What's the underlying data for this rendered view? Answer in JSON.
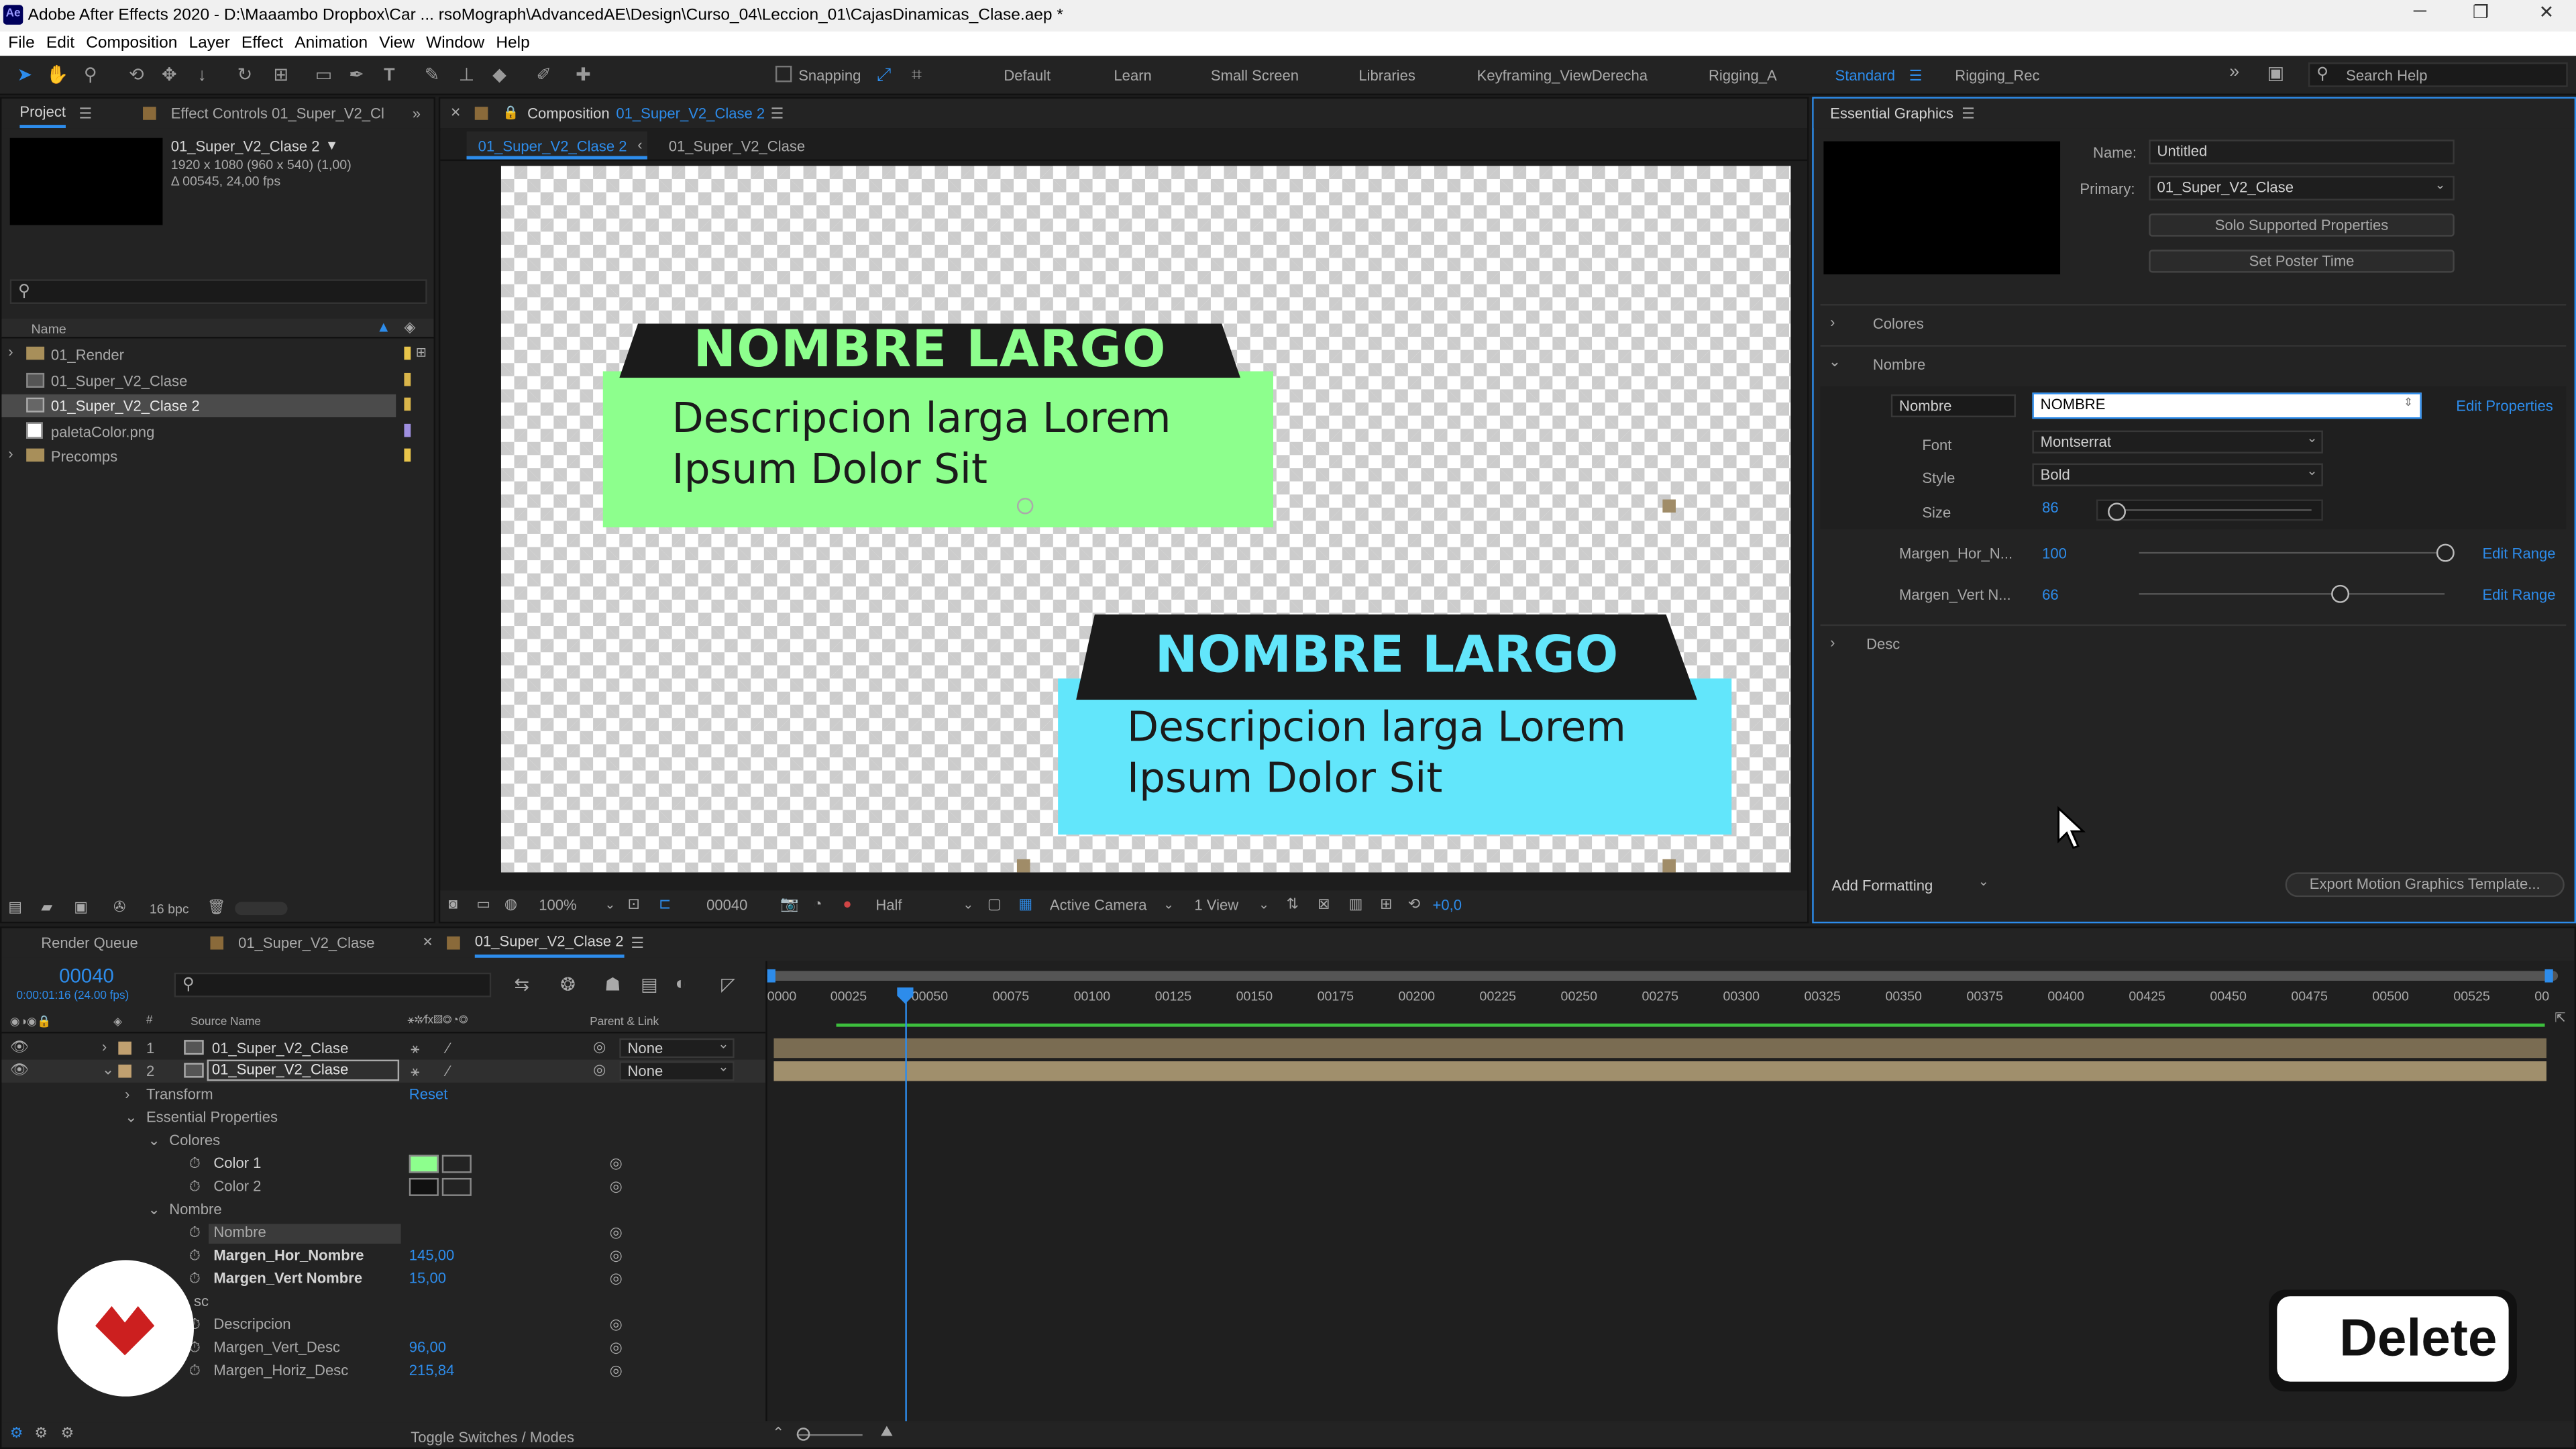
{
  "window": {
    "title": "Adobe After Effects 2020 - D:\\Maaambo Dropbox\\Car ... rsoMograph\\AdvancedAE\\Design\\Curso_04\\Leccion_01\\CajasDinamicas_Clase.aep *",
    "logo": "Ae"
  },
  "menu": [
    "File",
    "Edit",
    "Composition",
    "Layer",
    "Effect",
    "Animation",
    "View",
    "Window",
    "Help"
  ],
  "toolbar": {
    "snapping": "Snapping",
    "search_placeholder": "Search Help"
  },
  "workspaces": [
    "Default",
    "Learn",
    "Small Screen",
    "Libraries",
    "Keyframing_ViewDerecha",
    "Rigging_A",
    "Standard",
    "Rigging_Rec"
  ],
  "project": {
    "tab": "Project",
    "effect_tab": "Effect Controls 01_Super_V2_Cl",
    "item_name": "01_Super_V2_Clase 2",
    "item_info1": "1920 x 1080  (960 x 540) (1,00)",
    "item_info2": "Δ 00545, 24,00 fps",
    "col_name": "Name",
    "items": [
      {
        "name": "01_Render",
        "type": "folder",
        "color": "#e8c44a"
      },
      {
        "name": "01_Super_V2_Clase",
        "type": "comp",
        "color": "#d9b54a"
      },
      {
        "name": "01_Super_V2_Clase 2",
        "type": "comp",
        "color": "#d9b54a"
      },
      {
        "name": "paletaColor.png",
        "type": "image",
        "color": "#9f8fe0"
      },
      {
        "name": "Precomps",
        "type": "folder",
        "color": "#e8c44a"
      }
    ],
    "bpc": "16 bpc"
  },
  "comp": {
    "tab_label": "Composition",
    "tab_name": "01_Super_V2_Clase 2",
    "crumb1": "01_Super_V2_Clase 2",
    "crumb2": "01_Super_V2_Clase",
    "card1": {
      "title": "NOMBRE LARGO",
      "desc1": "Descripcion larga Lorem",
      "desc2": "Ipsum Dolor Sit",
      "color": "#8dff8d"
    },
    "card2": {
      "title": "NOMBRE LARGO",
      "desc1": "Descripcion larga Lorem",
      "desc2": "Ipsum Dolor Sit",
      "color": "#62e6fb"
    },
    "zoom": "100%",
    "time": "00040",
    "resolution": "Half",
    "camera": "Active Camera",
    "view": "1 View",
    "exposure": "+0,0"
  },
  "eg": {
    "title": "Essential Graphics",
    "name_label": "Name:",
    "name_value": "Untitled",
    "primary_label": "Primary:",
    "primary_value": "01_Super_V2_Clase",
    "solo": "Solo Supported Properties",
    "poster": "Set Poster Time",
    "section_colores": "Colores",
    "section_nombre": "Nombre",
    "nombre_label": "Nombre",
    "nombre_value": "NOMBRE",
    "edit_properties": "Edit Properties",
    "font_label": "Font",
    "font_value": "Montserrat",
    "style_label": "Style",
    "style_value": "Bold",
    "size_label": "Size",
    "size_value": "86",
    "margen_hor_label": "Margen_Hor_N...",
    "margen_hor_value": "100",
    "margen_vert_label": "Margen_Vert N...",
    "margen_vert_value": "66",
    "edit_range": "Edit Range",
    "section_desc": "Desc",
    "add_formatting": "Add Formatting",
    "export": "Export Motion Graphics Template..."
  },
  "timeline": {
    "tab_render": "Render Queue",
    "tab1": "01_Super_V2_Clase",
    "tab2": "01_Super_V2_Clase 2",
    "timecode": "00040",
    "timecode_sub": "0:00:01:16 (24.00 fps)",
    "col_source": "Source Name",
    "col_parent": "Parent & Link",
    "ruler": [
      "0000",
      "00025",
      "00050",
      "00075",
      "00100",
      "00125",
      "00150",
      "00175",
      "00200",
      "00225",
      "00250",
      "00275",
      "00300",
      "00325",
      "00350",
      "00375",
      "00400",
      "00425",
      "00450",
      "00475",
      "00500",
      "00525",
      "00"
    ],
    "layers": [
      {
        "num": "1",
        "name": "01_Super_V2_Clase",
        "parent": "None"
      },
      {
        "num": "2",
        "name": "01_Super_V2_Clase",
        "parent": "None"
      }
    ],
    "props": {
      "transform": "Transform",
      "reset": "Reset",
      "essential": "Essential Properties",
      "colores": "Colores",
      "color1": "Color 1",
      "color2": "Color 2",
      "nombre_group": "Nombre",
      "nombre": "Nombre",
      "margen_hor": "Margen_Hor_Nombre",
      "margen_hor_v": "145,00",
      "margen_vert": "Margen_Vert Nombre",
      "margen_vert_v": "15,00",
      "desc_group": "sc",
      "descripcion": "Descripcion",
      "margen_vert_desc": "Margen_Vert_Desc",
      "margen_vert_desc_v": "96,00",
      "margen_horiz_desc": "Margen_Horiz_Desc",
      "margen_horiz_desc_v": "215,84"
    },
    "toggle": "Toggle Switches / Modes"
  },
  "overlay": {
    "delete_key": "Delete"
  },
  "colors": {
    "accent": "#2d8ceb",
    "panel": "#232323",
    "green": "#8dff8d",
    "cyan": "#62e6fb",
    "logo_red": "#cc1f1f"
  }
}
